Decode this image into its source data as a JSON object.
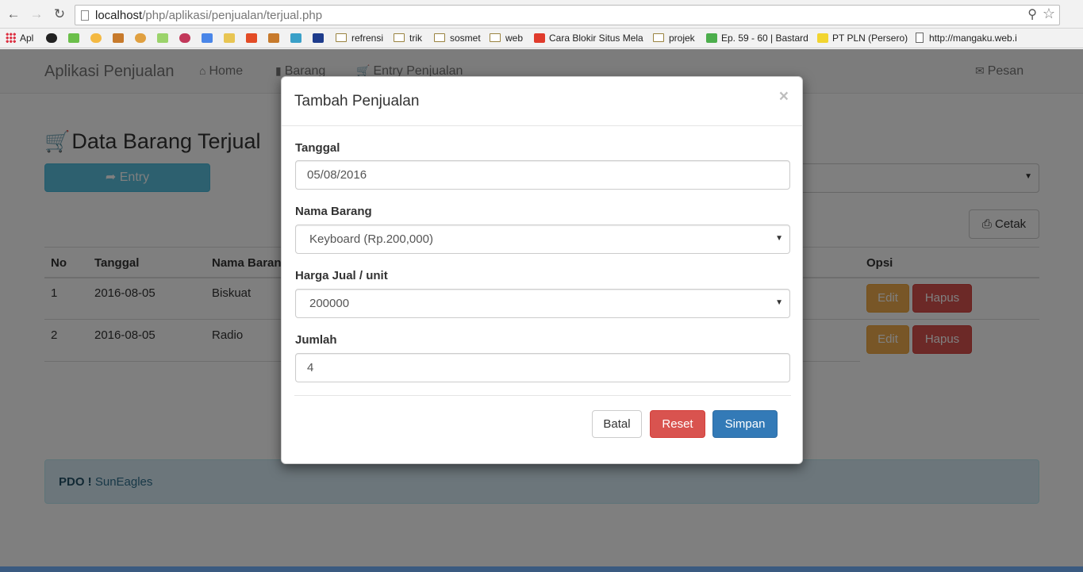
{
  "browser": {
    "url_host": "localhost",
    "url_path": "/php/aplikasi/penjualan/terjual.php",
    "bookmarks": {
      "apps": "Apl",
      "refrensi": "refrensi",
      "trik": "trik",
      "sosmet": "sosmet",
      "web": "web",
      "cara_blokir": "Cara Blokir Situs Mela",
      "projek": "projek",
      "bastard": "Ep. 59 - 60 | Bastard",
      "pln": "PT PLN (Persero)",
      "mangaku": "http://mangaku.web.i"
    }
  },
  "navbar": {
    "brand": "Aplikasi Penjualan",
    "home": "Home",
    "barang": "Barang",
    "entry_penjualan": "Entry Penjualan",
    "pesan": "Pesan"
  },
  "page": {
    "title": "Data Barang Terjual",
    "entry_button": "Entry",
    "cetak_button": "Cetak"
  },
  "table": {
    "headers": {
      "no": "No",
      "tanggal": "Tanggal",
      "nama_barang": "Nama Barang",
      "opsi": "Opsi"
    },
    "rows": [
      {
        "no": "1",
        "tanggal": "2016-08-05",
        "nama_barang": "Biskuat",
        "edit": "Edit",
        "hapus": "Hapus"
      },
      {
        "no": "2",
        "tanggal": "2016-08-05",
        "nama_barang": "Radio",
        "edit": "Edit",
        "hapus": "Hapus"
      }
    ]
  },
  "alert": {
    "strong": "PDO !",
    "text": "SunEagles"
  },
  "modal": {
    "title": "Tambah Penjualan",
    "close": "×",
    "tanggal_label": "Tanggal",
    "tanggal_value": "05/08/2016",
    "nama_barang_label": "Nama Barang",
    "nama_barang_value": "Keyboard (Rp.200,000)",
    "harga_label": "Harga Jual / unit",
    "harga_value": "200000",
    "jumlah_label": "Jumlah",
    "jumlah_value": "4",
    "batal": "Batal",
    "reset": "Reset",
    "simpan": "Simpan"
  },
  "colors": {
    "info": "#5bc0de",
    "warning": "#f0ad4e",
    "danger": "#d9534f",
    "primary": "#337ab7",
    "alert_bg": "#d9edf7"
  }
}
